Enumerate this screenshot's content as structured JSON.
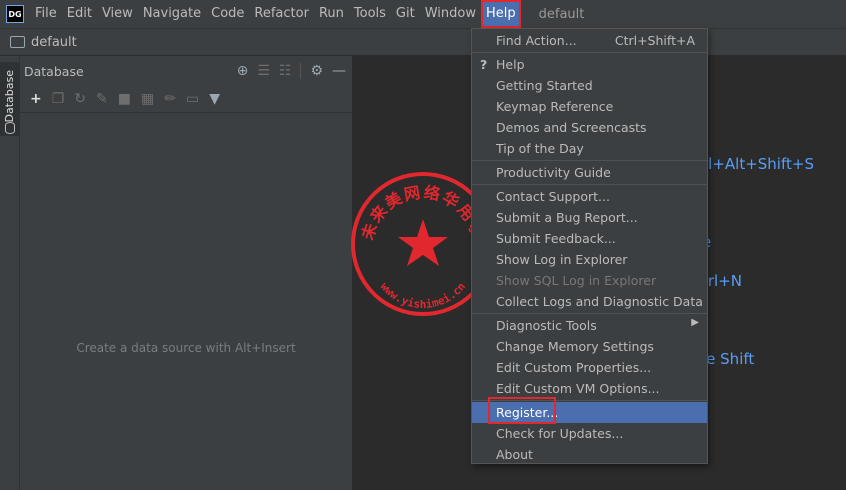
{
  "app": {
    "logo_text": "DG",
    "project_title": "default"
  },
  "menubar": {
    "items": [
      "File",
      "Edit",
      "View",
      "Navigate",
      "Code",
      "Refactor",
      "Run",
      "Tools",
      "Git",
      "Window",
      "Help"
    ]
  },
  "navbar": {
    "breadcrumb": "default"
  },
  "side_strip": {
    "tab_label": "Database"
  },
  "db_panel": {
    "title": "Database",
    "empty_text": "Create a data source with Alt+Insert",
    "header_icons": [
      "crosshair-icon",
      "expand-all-icon",
      "collapse-all-icon",
      "gear-icon",
      "minimize-icon"
    ],
    "toolbar_icons": [
      "add-icon",
      "copy-icon",
      "refresh-icon",
      "properties-icon",
      "stop-icon",
      "table-icon",
      "edit-icon",
      "console-icon",
      "filter-icon"
    ]
  },
  "editor": {
    "shortcut_fragments": [
      "rl+Alt+Shift+S",
      "e",
      "trl+N",
      "le Shift"
    ],
    "accent": "#589df6"
  },
  "help_menu": {
    "items": [
      {
        "label": "Find Action...",
        "shortcut": "Ctrl+Shift+A"
      },
      {
        "label": "Help",
        "icon": "question-icon"
      },
      {
        "label": "Getting Started"
      },
      {
        "label": "Keymap Reference"
      },
      {
        "label": "Demos and Screencasts"
      },
      {
        "label": "Tip of the Day"
      },
      {
        "label": "Productivity Guide"
      },
      {
        "label": "Contact Support..."
      },
      {
        "label": "Submit a Bug Report..."
      },
      {
        "label": "Submit Feedback..."
      },
      {
        "label": "Show Log in Explorer"
      },
      {
        "label": "Show SQL Log in Explorer",
        "disabled": true
      },
      {
        "label": "Collect Logs and Diagnostic Data"
      },
      {
        "label": "Diagnostic Tools",
        "submenu": true
      },
      {
        "label": "Change Memory Settings"
      },
      {
        "label": "Edit Custom Properties..."
      },
      {
        "label": "Edit Custom VM Options..."
      },
      {
        "label": "Register...",
        "selected": true
      },
      {
        "label": "Check for Updates..."
      },
      {
        "label": "About"
      }
    ]
  },
  "watermark": {
    "text_top": "未来美网络华用事",
    "text_bottom": "www.yishimei.cn",
    "color": "#e0282e"
  },
  "colors": {
    "highlight": "#e0282e",
    "selection": "#4b6eaf"
  }
}
